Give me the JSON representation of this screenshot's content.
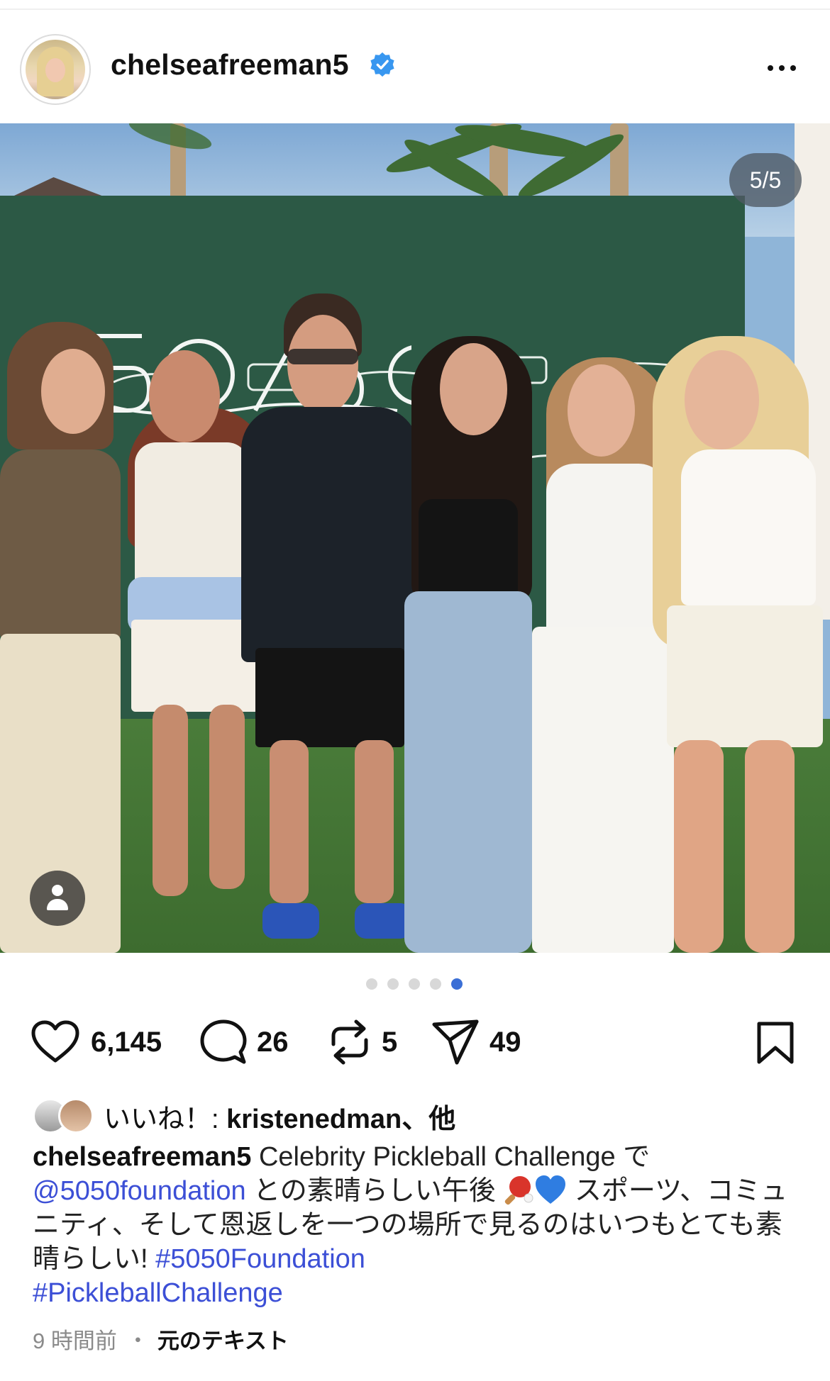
{
  "header": {
    "username": "chelseafreeman5",
    "verified": true,
    "more_icon": "ellipsis-icon"
  },
  "post": {
    "image_counter": "5/5",
    "carousel": {
      "total": 5,
      "active_index": 5
    },
    "tag_icon": "person-icon"
  },
  "actions": {
    "likes_count": "6,145",
    "comments_count": "26",
    "reposts_count": "5",
    "shares_count": "49"
  },
  "likes_line": {
    "prefix": "いいね！: ",
    "user": "kristenedman",
    "suffix": "、他"
  },
  "caption": {
    "user": "chelseafreeman5",
    "text_part1": " Celebrity Pickleball Challenge で ",
    "mention": "@5050foundation",
    "text_part2": " との素晴らしい午後 ",
    "text_part3": " スポーツ、コミュニティ、そして恩返しを一つの場所で見るのはいつもとても素晴らしい! ",
    "hashtag1": "#5050Foundation",
    "hashtag2": "#PickleballChallenge"
  },
  "meta": {
    "time": "9 時間前",
    "separator": "・",
    "translate_label": "元のテキスト"
  },
  "colors": {
    "accent_blue": "#3b6fd6",
    "link_color": "#3c4fd6",
    "verified_blue": "#3897f0"
  }
}
